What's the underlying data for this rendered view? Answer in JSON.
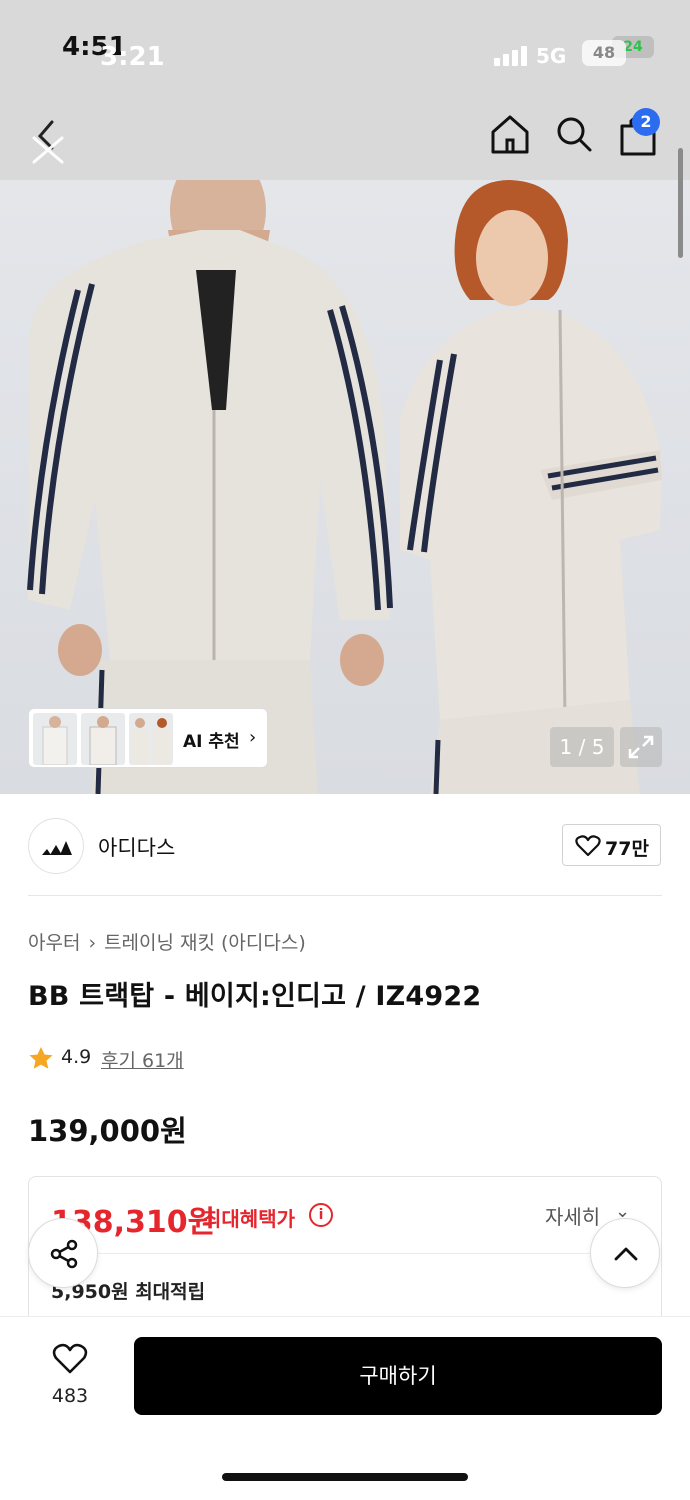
{
  "status": {
    "time": "4:51",
    "time_overlay": "3:21",
    "network": "5G",
    "battery": "48",
    "battery_overlay": "24"
  },
  "header": {
    "back_icon": "back-arrow-icon",
    "home_icon": "home-icon",
    "search_icon": "search-icon",
    "cart_icon": "cart-icon",
    "cart_count": "2"
  },
  "gallery": {
    "ai_label": "AI 추천",
    "ai_chevron": "›",
    "counter": "1 / 5",
    "expand_icon": "expand-icon"
  },
  "brand": {
    "name": "아디다스",
    "likes": "77만"
  },
  "product": {
    "breadcrumbs": [
      "아우터",
      "트레이닝 재킷 (아디다스)"
    ],
    "breadcrumb_sep": "›",
    "title": "BB 트랙탑 - 베이지:인디고 / IZ4922",
    "rating": "4.9",
    "reviews": "후기 61개",
    "price": "139,000원"
  },
  "benefit": {
    "sale_price": "138,310원",
    "sale_label": "최대혜택가",
    "info_icon": "i",
    "detail_label": "자세히",
    "detail_chevron": "⌄",
    "point_text": "5,950원 최대적립"
  },
  "bottom": {
    "wish_count": "483",
    "buy_label": "구매하기"
  },
  "colors": {
    "accent_red": "#e5262d",
    "badge_blue": "#2b6cf0",
    "buy_button": "#000000"
  }
}
